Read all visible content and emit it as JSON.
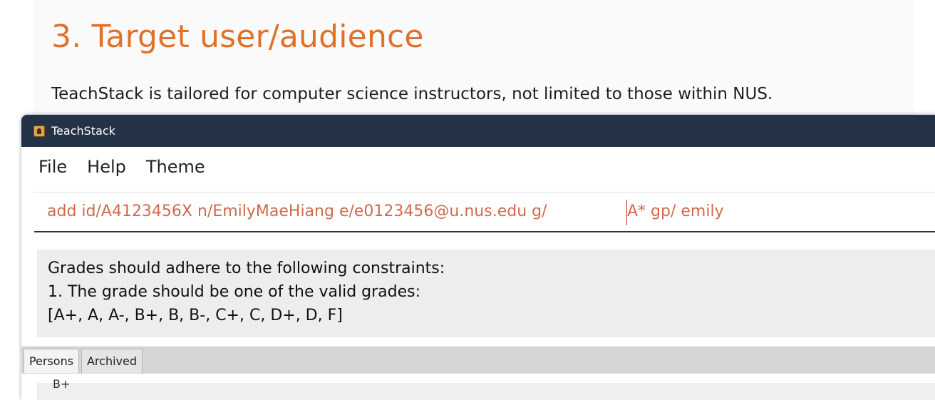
{
  "document": {
    "heading": "3. Target user/audience",
    "paragraph": "TeachStack is tailored for computer science instructors, not limited to those within NUS."
  },
  "window": {
    "title": "TeachStack",
    "title_bar_color": "#243248"
  },
  "menu": {
    "items": [
      "File",
      "Help",
      "Theme"
    ]
  },
  "command_box": {
    "value_before_cursor": "add id/A4123456X n/EmilyMaeHiang e/e0123456@u.nus.edu g/",
    "value_after_cursor": "A* gp/ emily",
    "text_color": "#d06a4c"
  },
  "result_display": {
    "lines": [
      "Grades should adhere to the following constraints:",
      "1. The grade should be one of the valid grades:",
      "[A+, A, A-, B+, B, B-, C+, C, D+, D, F]"
    ]
  },
  "tabs": [
    {
      "label": "Persons",
      "selected": true
    },
    {
      "label": "Archived",
      "selected": false
    }
  ],
  "person_list": {
    "partial_item_text": "B+"
  },
  "colors": {
    "heading": "#e0712a",
    "result_background": "#ededed"
  }
}
